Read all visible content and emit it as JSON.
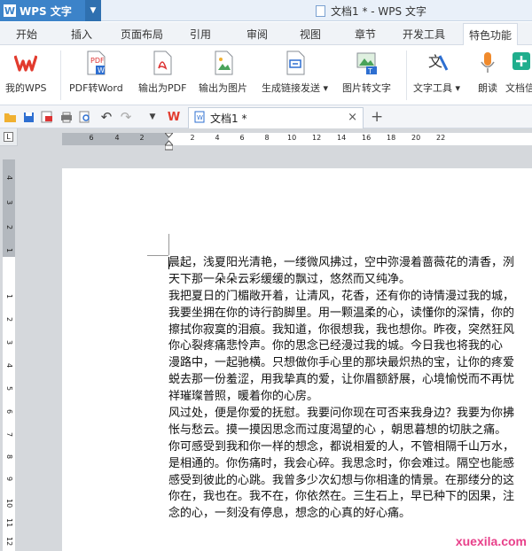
{
  "app": {
    "name": "WPS 文字",
    "logo": "W",
    "doc_title": "文档1 * - WPS 文字"
  },
  "tabs": [
    {
      "label": "开始"
    },
    {
      "label": "插入"
    },
    {
      "label": "页面布局"
    },
    {
      "label": "引用"
    },
    {
      "label": "审阅"
    },
    {
      "label": "视图"
    },
    {
      "label": "章节"
    },
    {
      "label": "开发工具"
    },
    {
      "label": "特色功能",
      "active": true
    }
  ],
  "ribbon": {
    "buttons": [
      {
        "label": "我的WPS",
        "icon": "wps-logo-icon"
      },
      {
        "label": "PDF转Word",
        "icon": "pdf-to-word-icon"
      },
      {
        "label": "输出为PDF",
        "icon": "export-pdf-icon"
      },
      {
        "label": "输出为图片",
        "icon": "export-image-icon"
      },
      {
        "label": "生成链接发送",
        "icon": "share-link-icon",
        "dropdown": true
      },
      {
        "label": "图片转文字",
        "icon": "image-to-text-icon"
      },
      {
        "label": "文字工具",
        "icon": "text-tools-icon",
        "dropdown": true
      },
      {
        "label": "朗读",
        "icon": "microphone-icon"
      },
      {
        "label": "文档信",
        "icon": "doc-info-icon"
      }
    ]
  },
  "quick_access": [
    "open-folder-icon",
    "save-icon",
    "export-pdf-icon",
    "print-icon",
    "print-preview-icon",
    "undo-icon",
    "redo-icon",
    "customize-dropdown-icon"
  ],
  "doc_tab": {
    "logo": "W",
    "title": "文档1 *",
    "close": "×",
    "new_tab": "+"
  },
  "ruler": {
    "corner": "L",
    "h_numbers": [
      "6",
      "4",
      "2",
      "",
      "2",
      "4",
      "6",
      "8",
      "10",
      "12",
      "14",
      "16",
      "18",
      "20",
      "22"
    ],
    "v_numbers": [
      "4",
      "3",
      "2",
      "1",
      "",
      "1",
      "2",
      "3",
      "4",
      "5",
      "6",
      "7",
      "8",
      "9",
      "10",
      "11",
      "12",
      "13",
      "14",
      "15",
      "16"
    ]
  },
  "document": {
    "lines": [
      "晨起，浅夏阳光清艳，一缕微风拂过，空中弥漫着蔷薇花的清香，洌",
      "天下那一朵朵云彩缓缓的飘过，悠然而又纯净。",
      "我把夏日的门楣敞开着，让清风，花香，还有你的诗情漫过我的城，",
      "我要坐拥在你的诗行韵脚里。用一颗温柔的心，读懂你的深情，你的",
      "擦拭你寂寞的泪痕。我知道，你很想我，我也想你。昨夜，突然狂风",
      "你心裂疼痛悲怜声。你的思念已经漫过我的城。今日我也将我的心",
      "漫路中，一起驰横。只想做你手心里的那块最炽热的宝，让你的疼爱",
      "蜕去那一份羞涩，用我挚真的爱，让你眉额舒展，心境愉悦而不再忧",
      "祥璀璨普照，暖着你的心房。",
      "风过处，便是你爱的抚慰。我要问你现在可否来我身边？我要为你拂",
      "怅与愁云。摸一摸因思念而过度渴望的心 ，朝思暮想的切肤之痛。",
      "你可感受到我和你一样的想念，都说相爱的人，不管相隔千山万水，",
      "是相通的。你伤痛时，我会心碎。我思念时，你会难过。隔空也能感",
      "感受到彼此的心跳。我曾多少次幻想与你相逢的情景。在那缕分的这",
      "你在，我也在。我不在，你依然在。三生石上，早已种下的因果，注",
      "念的心，一刻没有停息，想念的心真的好心痛。"
    ]
  },
  "watermark": "xuexila.com"
}
